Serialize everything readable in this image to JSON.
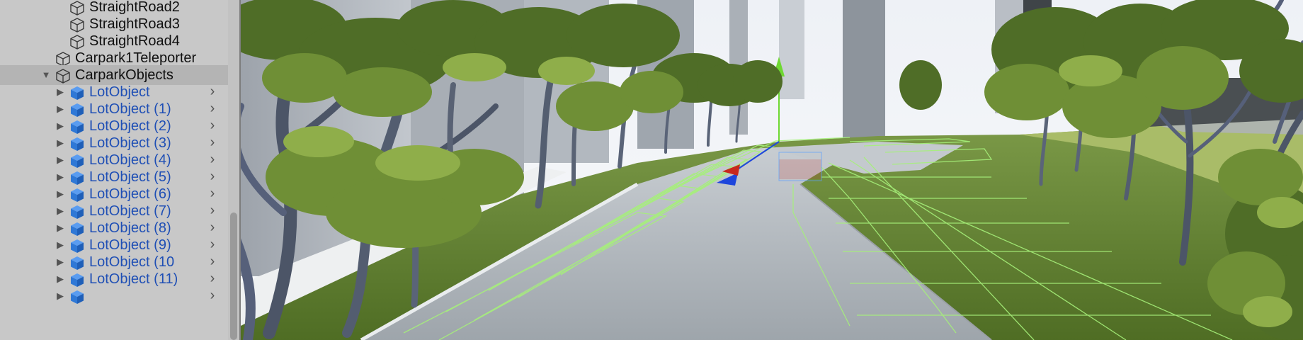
{
  "hierarchy": {
    "items": [
      {
        "label": "StraightRoad2",
        "icon": "cube-outline-icon",
        "level": 2,
        "prefab": false,
        "expandable": false,
        "selected": false,
        "chevron": false
      },
      {
        "label": "StraightRoad3",
        "icon": "cube-outline-icon",
        "level": 2,
        "prefab": false,
        "expandable": false,
        "selected": false,
        "chevron": false
      },
      {
        "label": "StraightRoad4",
        "icon": "cube-outline-icon",
        "level": 2,
        "prefab": false,
        "expandable": false,
        "selected": false,
        "chevron": false
      },
      {
        "label": "Carpark1Teleporter",
        "icon": "cube-outline-icon",
        "level": 1,
        "prefab": false,
        "expandable": false,
        "selected": false,
        "chevron": false
      },
      {
        "label": "CarparkObjects",
        "icon": "cube-outline-icon",
        "level": 1,
        "prefab": false,
        "expandable": true,
        "expanded": true,
        "selected": true,
        "chevron": false
      },
      {
        "label": "LotObject",
        "icon": "prefab-cube-icon",
        "level": 2,
        "prefab": true,
        "expandable": true,
        "expanded": false,
        "selected": false,
        "chevron": true
      },
      {
        "label": "LotObject (1)",
        "icon": "prefab-cube-icon",
        "level": 2,
        "prefab": true,
        "expandable": true,
        "expanded": false,
        "selected": false,
        "chevron": true
      },
      {
        "label": "LotObject (2)",
        "icon": "prefab-cube-icon",
        "level": 2,
        "prefab": true,
        "expandable": true,
        "expanded": false,
        "selected": false,
        "chevron": true
      },
      {
        "label": "LotObject (3)",
        "icon": "prefab-cube-icon",
        "level": 2,
        "prefab": true,
        "expandable": true,
        "expanded": false,
        "selected": false,
        "chevron": true
      },
      {
        "label": "LotObject (4)",
        "icon": "prefab-cube-icon",
        "level": 2,
        "prefab": true,
        "expandable": true,
        "expanded": false,
        "selected": false,
        "chevron": true
      },
      {
        "label": "LotObject (5)",
        "icon": "prefab-cube-icon",
        "level": 2,
        "prefab": true,
        "expandable": true,
        "expanded": false,
        "selected": false,
        "chevron": true
      },
      {
        "label": "LotObject (6)",
        "icon": "prefab-cube-icon",
        "level": 2,
        "prefab": true,
        "expandable": true,
        "expanded": false,
        "selected": false,
        "chevron": true
      },
      {
        "label": "LotObject (7)",
        "icon": "prefab-cube-icon",
        "level": 2,
        "prefab": true,
        "expandable": true,
        "expanded": false,
        "selected": false,
        "chevron": true
      },
      {
        "label": "LotObject (8)",
        "icon": "prefab-cube-icon",
        "level": 2,
        "prefab": true,
        "expandable": true,
        "expanded": false,
        "selected": false,
        "chevron": true
      },
      {
        "label": "LotObject (9)",
        "icon": "prefab-cube-icon",
        "level": 2,
        "prefab": true,
        "expandable": true,
        "expanded": false,
        "selected": false,
        "chevron": true
      },
      {
        "label": "LotObject (10",
        "icon": "prefab-cube-icon",
        "level": 2,
        "prefab": true,
        "expandable": true,
        "expanded": false,
        "selected": false,
        "chevron": true
      },
      {
        "label": "LotObject (11)",
        "icon": "prefab-cube-icon",
        "level": 2,
        "prefab": true,
        "expandable": true,
        "expanded": false,
        "selected": false,
        "chevron": true
      },
      {
        "label": "",
        "icon": "prefab-cube-icon",
        "level": 2,
        "prefab": true,
        "expandable": true,
        "expanded": false,
        "selected": false,
        "chevron": true
      }
    ]
  },
  "colors": {
    "panel_bg": "#c8c8c8",
    "selected_row": "#b4b4b4",
    "prefab_text": "#1f4fb5",
    "prefab_icon": "#2f78d6",
    "gizmo_y": "#6ed832",
    "gizmo_x": "#c8281e",
    "gizmo_z": "#1e46dc",
    "wireframe": "#a6f07a",
    "grass": "#5c7a2c",
    "sky": "#f2f4f7"
  },
  "scene": {
    "content": "3D scene view: park path lined with trees, wireframe lot objects, move gizmo"
  }
}
